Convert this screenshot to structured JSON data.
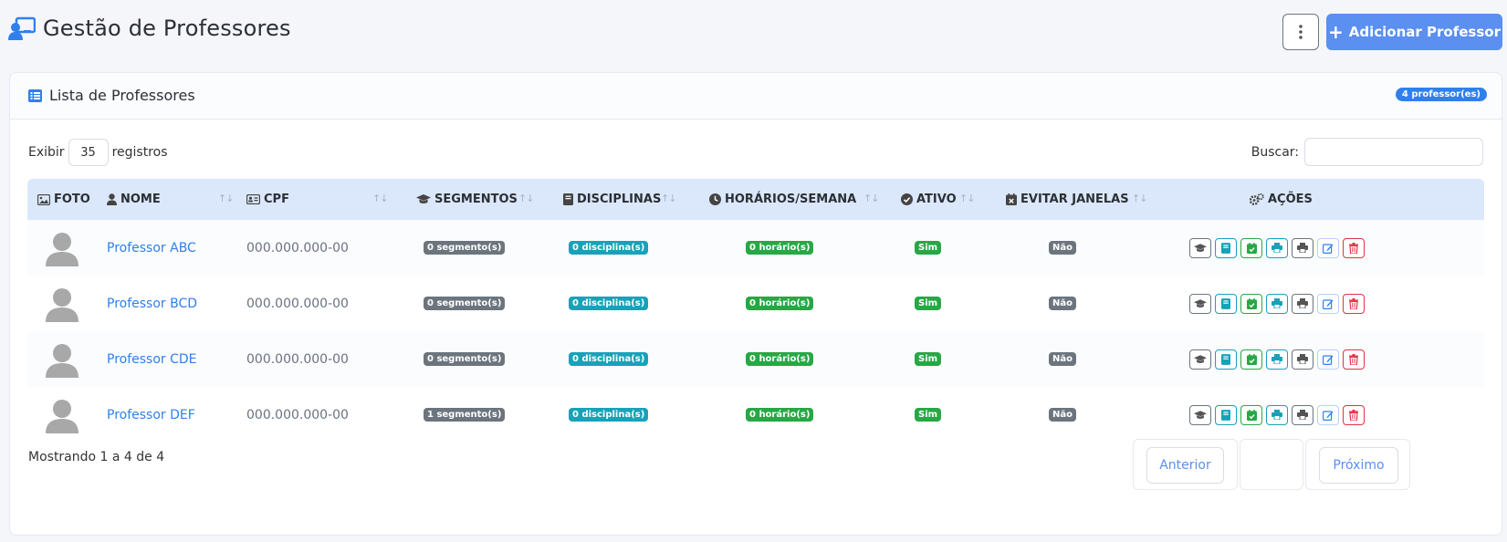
{
  "header": {
    "title": "Gestão de Professores",
    "add_button_label": "Adicionar Professor"
  },
  "card": {
    "title": "Lista de Professores",
    "count_badge": "4 professor(es)"
  },
  "controls": {
    "length_prefix": "Exibir",
    "length_value": "35",
    "length_suffix": "registros",
    "search_label": "Buscar:",
    "search_value": ""
  },
  "table": {
    "columns": [
      "FOTO",
      "NOME",
      "CPF",
      "SEGMENTOS",
      "DISCIPLINAS",
      "HORÁRIOS/SEMANA",
      "ATIVO",
      "EVITAR JANELAS",
      "AÇÕES"
    ],
    "rows": [
      {
        "nome": "Professor ABC",
        "cpf": "000.000.000-00",
        "segmentos": "0 segmento(s)",
        "disciplinas": "0 disciplina(s)",
        "horarios": "0 horário(s)",
        "ativo": "Sim",
        "evitar_janelas": "Não"
      },
      {
        "nome": "Professor BCD",
        "cpf": "000.000.000-00",
        "segmentos": "0 segmento(s)",
        "disciplinas": "0 disciplina(s)",
        "horarios": "0 horário(s)",
        "ativo": "Sim",
        "evitar_janelas": "Não"
      },
      {
        "nome": "Professor CDE",
        "cpf": "000.000.000-00",
        "segmentos": "0 segmento(s)",
        "disciplinas": "0 disciplina(s)",
        "horarios": "0 horário(s)",
        "ativo": "Sim",
        "evitar_janelas": "Não"
      },
      {
        "nome": "Professor DEF",
        "cpf": "000.000.000-00",
        "segmentos": "1 segmento(s)",
        "disciplinas": "0 disciplina(s)",
        "horarios": "0 horário(s)",
        "ativo": "Sim",
        "evitar_janelas": "Não"
      }
    ]
  },
  "footer": {
    "info": "Mostrando 1 a 4 de 4",
    "prev_label": "Anterior",
    "next_label": "Próximo"
  },
  "colors": {
    "primary": "#2f80ed",
    "button": "#5b8ff0",
    "header_bg": "#dbe8fb",
    "badge_gray": "#6c757d",
    "badge_cyan": "#17a2b8",
    "badge_green": "#28a745",
    "danger": "#dc3545"
  },
  "icons": {
    "page_title": "user-chalkboard-icon",
    "more": "vertical-dots-icon",
    "card_title": "list-icon",
    "row_actions": [
      "graduation-cap-icon",
      "book-icon",
      "calendar-check-icon",
      "print-icon",
      "print-icon",
      "edit-icon",
      "trash-icon"
    ]
  }
}
